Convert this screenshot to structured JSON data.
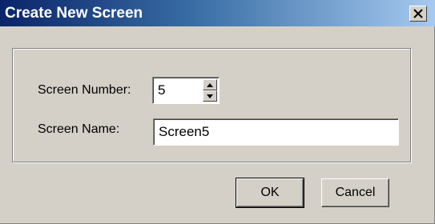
{
  "window": {
    "title": "Create New Screen",
    "close_label": "✕"
  },
  "form": {
    "screen_number_label": "Screen Number:",
    "screen_number_value": "5",
    "screen_name_label": "Screen Name:",
    "screen_name_value": "Screen5"
  },
  "buttons": {
    "ok_label": "OK",
    "cancel_label": "Cancel"
  },
  "colors": {
    "title_bar_start": "#0a246a",
    "title_bar_end": "#a6caf0",
    "dialog_face": "#d4d0c8"
  },
  "icons": {
    "close": "close-icon",
    "spin_up": "spin-up-arrow-icon",
    "spin_down": "spin-down-arrow-icon"
  }
}
